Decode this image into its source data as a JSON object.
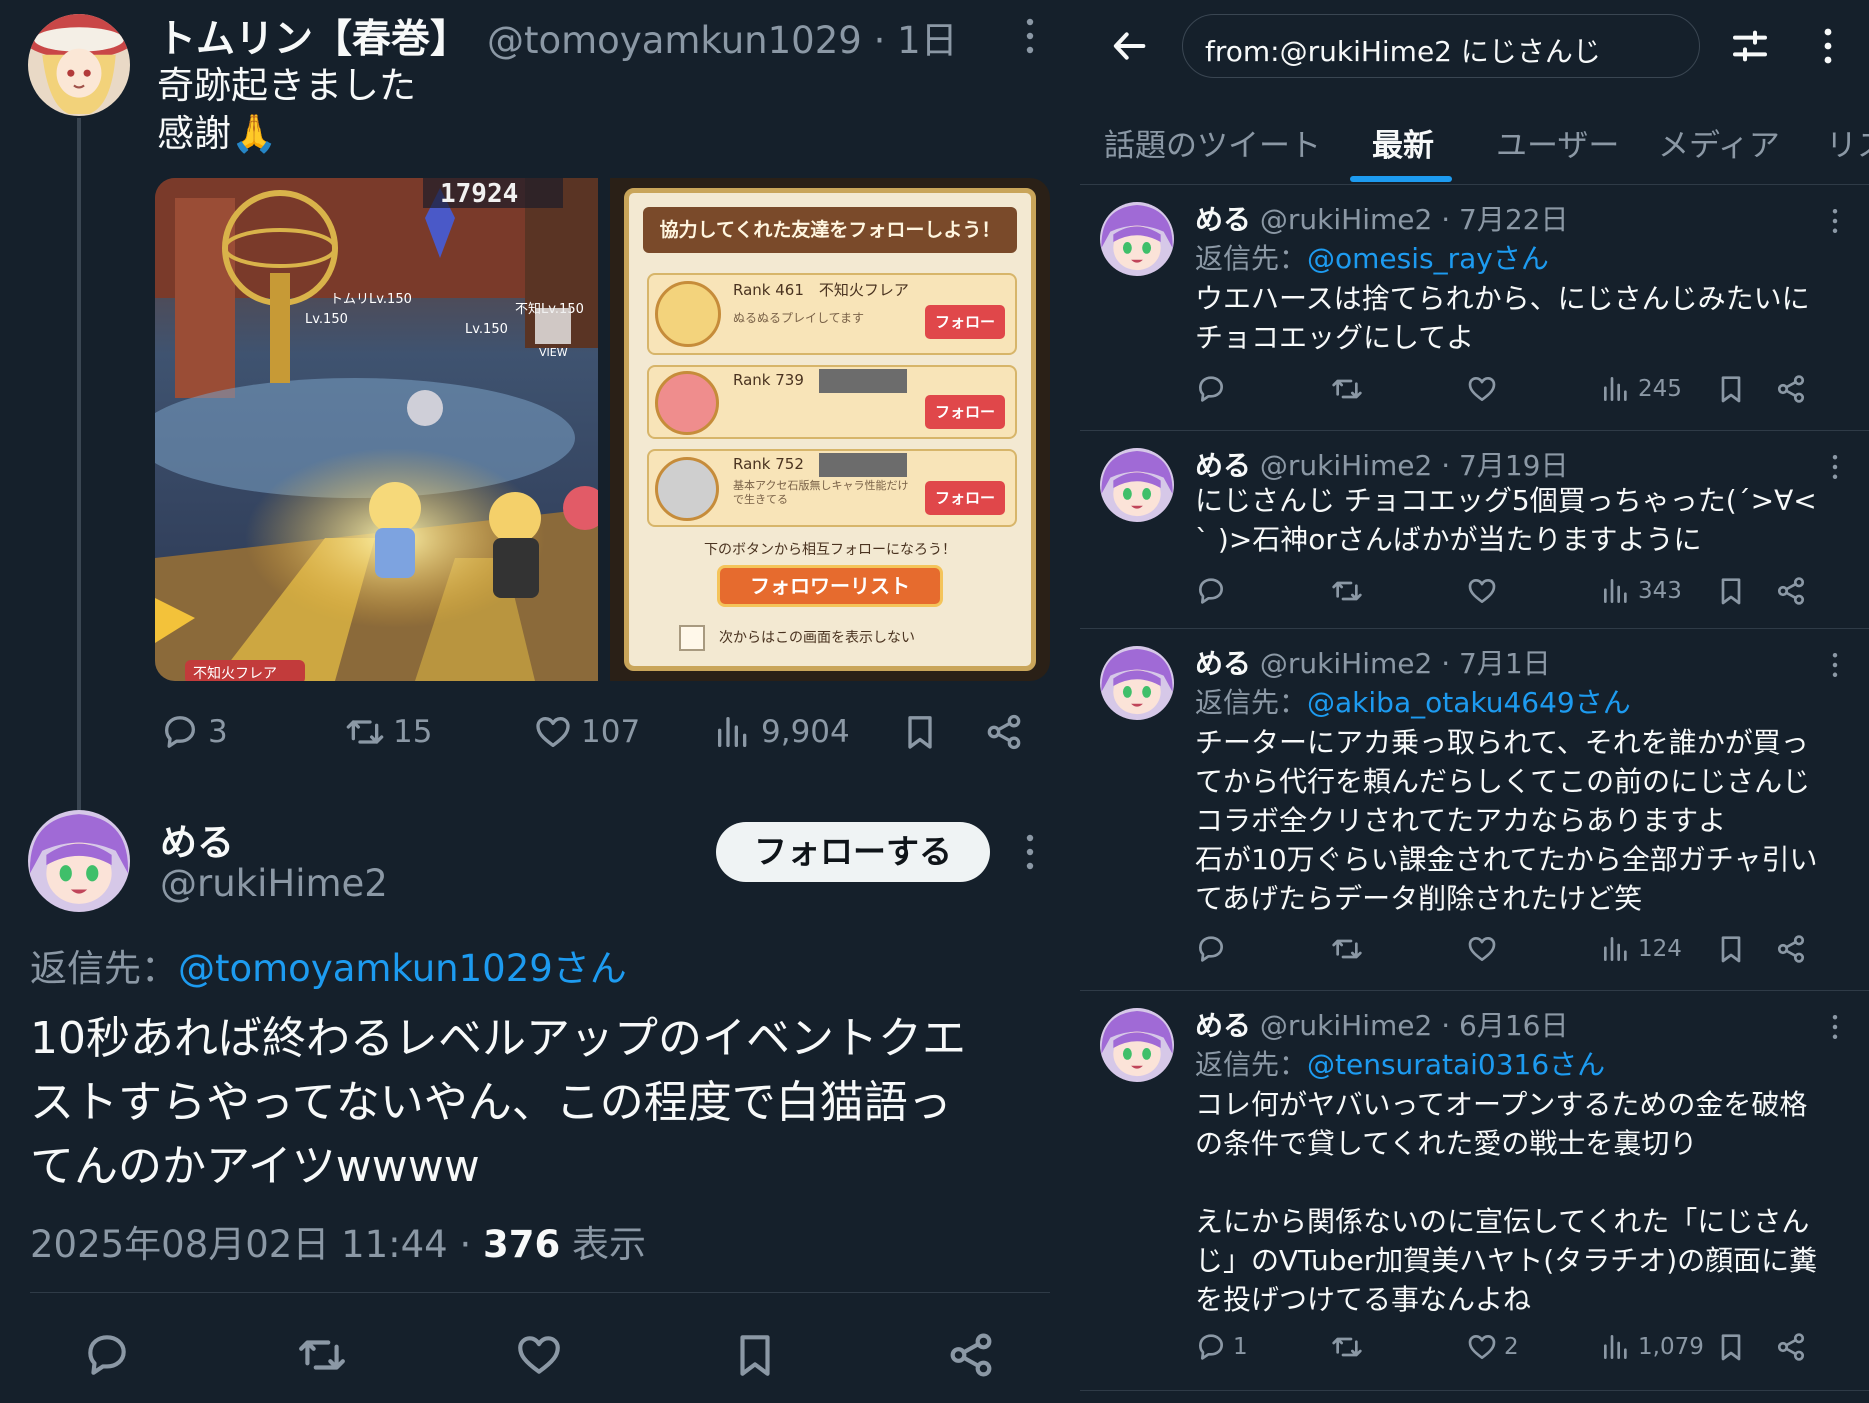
{
  "original_tweet": {
    "display_name": "トムリン【春巻】",
    "handle": "@tomoyamkun1029",
    "time": "· 1日",
    "text_line1": "奇跡起きました",
    "text_line2": "感謝🙏",
    "images": {
      "left": {
        "score": "17924",
        "labels": [
          "トムリLv.150",
          "Lv.150",
          "Lv.150",
          "不知Lv.150",
          "VIEW",
          "不知火フレア"
        ]
      },
      "right": {
        "title": "協力してくれた友達をフォローしよう！",
        "cards": [
          {
            "rank": "Rank 461",
            "name": "不知火フレア",
            "comment": "ぬるぬるプレイしてます",
            "follow": "フォロー"
          },
          {
            "rank": "Rank 739",
            "name": "",
            "comment": "",
            "follow": "フォロー"
          },
          {
            "rank": "Rank 752",
            "name": "",
            "comment": "基本アクセ石版無しキャラ性能だけで生きてる",
            "follow": "フォロー"
          }
        ],
        "hint": "下のボタンから相互フォローになろう！",
        "list_button": "フォロワーリスト",
        "checkbox_label": "次からはこの画面を表示しない"
      }
    },
    "stats": {
      "replies": "3",
      "retweets": "15",
      "likes": "107",
      "views": "9,904"
    }
  },
  "reply_tweet": {
    "display_name": "める",
    "handle": "@rukiHime2",
    "follow_button": "フォローする",
    "reply_to_prefix": "返信先：",
    "reply_to_handle": "@tomoyamkun1029さん",
    "text_line1": "10秒あれば終わるレベルアップのイベントクエ",
    "text_line2": "ストすらやってないやん、この程度で白猫語っ",
    "text_line3": "てんのかアイツwwww",
    "timestamp": "2025年08月02日 11:44 ·",
    "views_count": "376",
    "views_label": "表示"
  },
  "search": {
    "query": "from:@rukiHime2 にじさんじ",
    "tabs": [
      "話題のツイート",
      "最新",
      "ユーザー",
      "メディア",
      "リス"
    ],
    "active_tab": 1,
    "results": [
      {
        "name": "める",
        "handle": "@rukiHime2",
        "date": "· 7月22日",
        "reply_prefix": "返信先：",
        "reply_to": "@omesis_rayさん",
        "lines": [
          "ウエハースは捨てられから、にじさんじみたいに",
          "チョコエッグにしてよ"
        ],
        "replies": "",
        "retweets": "",
        "likes": "",
        "views": "245"
      },
      {
        "name": "める",
        "handle": "@rukiHime2",
        "date": "· 7月19日",
        "reply_prefix": "",
        "reply_to": "",
        "lines": [
          "にじさんじ チョコエッグ5個買っちゃった(´>∀<",
          "` )>石神orさんばかが当たりますように"
        ],
        "replies": "",
        "retweets": "",
        "likes": "",
        "views": "343"
      },
      {
        "name": "める",
        "handle": "@rukiHime2",
        "date": "· 7月1日",
        "reply_prefix": "返信先：",
        "reply_to": "@akiba_otaku4649さん",
        "lines": [
          "チーターにアカ乗っ取られて、それを誰かが買っ",
          "てから代行を頼んだらしくてこの前のにじさんじ",
          "コラボ全クリされてたアカならありますよ",
          "石が10万ぐらい課金されてたから全部ガチャ引い",
          "てあげたらデータ削除されたけど笑"
        ],
        "replies": "",
        "retweets": "",
        "likes": "",
        "views": "124"
      },
      {
        "name": "める",
        "handle": "@rukiHime2",
        "date": "· 6月16日",
        "reply_prefix": "返信先：",
        "reply_to": "@tensuratai0316さん",
        "lines": [
          "コレ何がヤバいってオープンするための金を破格",
          "の条件で貸してくれた愛の戦士を裏切り",
          "",
          "えにから関係ないのに宣伝してくれた「にじさん",
          "じ」のVTuber加賀美ハヤト(タラチオ)の顔面に糞",
          "を投げつけてる事なんよね"
        ],
        "replies": "1",
        "retweets": "",
        "likes": "2",
        "views": "1,079"
      }
    ]
  },
  "colors": {
    "background": "#15202b",
    "text": "#f7f9f9",
    "muted": "#8b98a5",
    "link": "#1d9bf0",
    "divider": "#2f3b47"
  }
}
